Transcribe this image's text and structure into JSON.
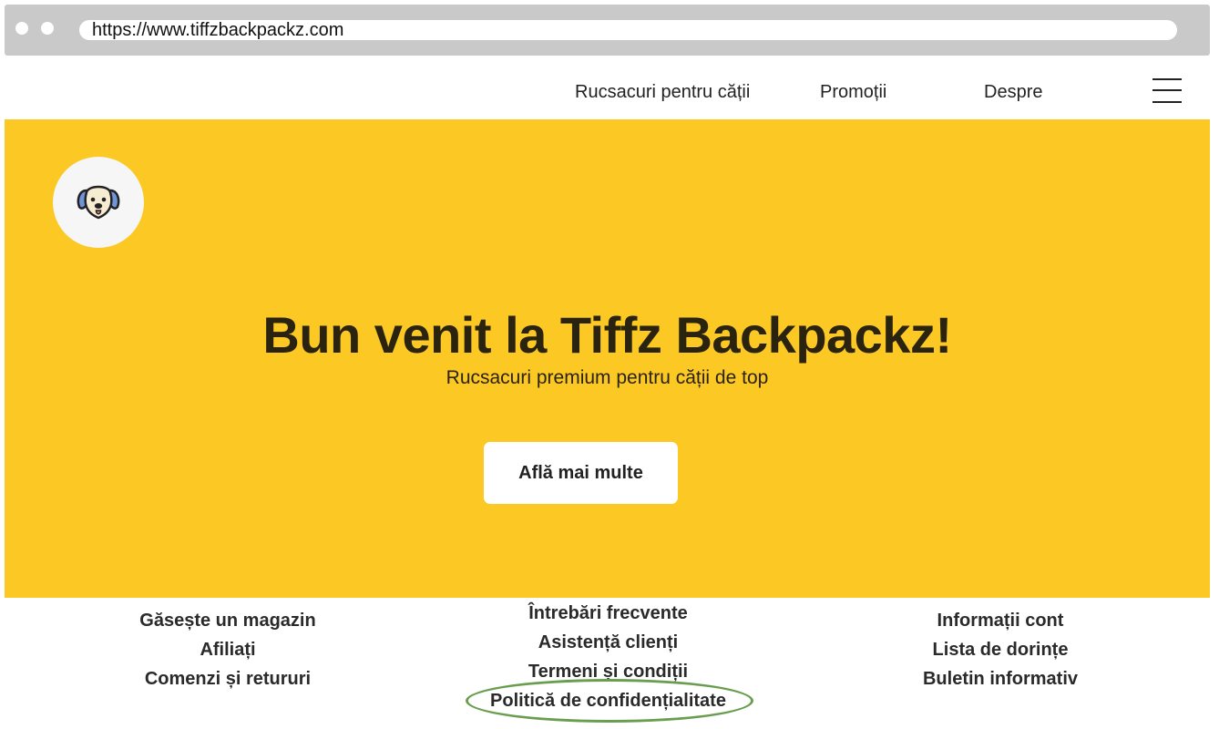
{
  "browser": {
    "url": "https://www.tiffzbackpackz.com"
  },
  "nav": {
    "items": [
      {
        "label": "Rucsacuri pentru cății"
      },
      {
        "label": "Promoții"
      },
      {
        "label": "Despre"
      }
    ],
    "menu_icon": "hamburger-menu-icon"
  },
  "hero": {
    "logo_icon": "dog-face-icon",
    "title": "Bun venit la Tiffz Backpackz!",
    "subtitle": "Rucsacuri premium pentru cății de top",
    "button_label": "Află mai multe",
    "background_color": "#fcc824"
  },
  "footer": {
    "columns": [
      {
        "links": [
          "Găsește un magazin",
          "Afiliați",
          "Comenzi și retururi"
        ]
      },
      {
        "links": [
          "Întrebări frecvente",
          "Asistență clienți",
          "Termeni și condiții",
          "Politică de confidențialitate"
        ]
      },
      {
        "links": [
          "Informații cont",
          "Lista de dorințe",
          "Buletin informativ"
        ]
      }
    ],
    "highlight_color": "#6a9e4f"
  }
}
